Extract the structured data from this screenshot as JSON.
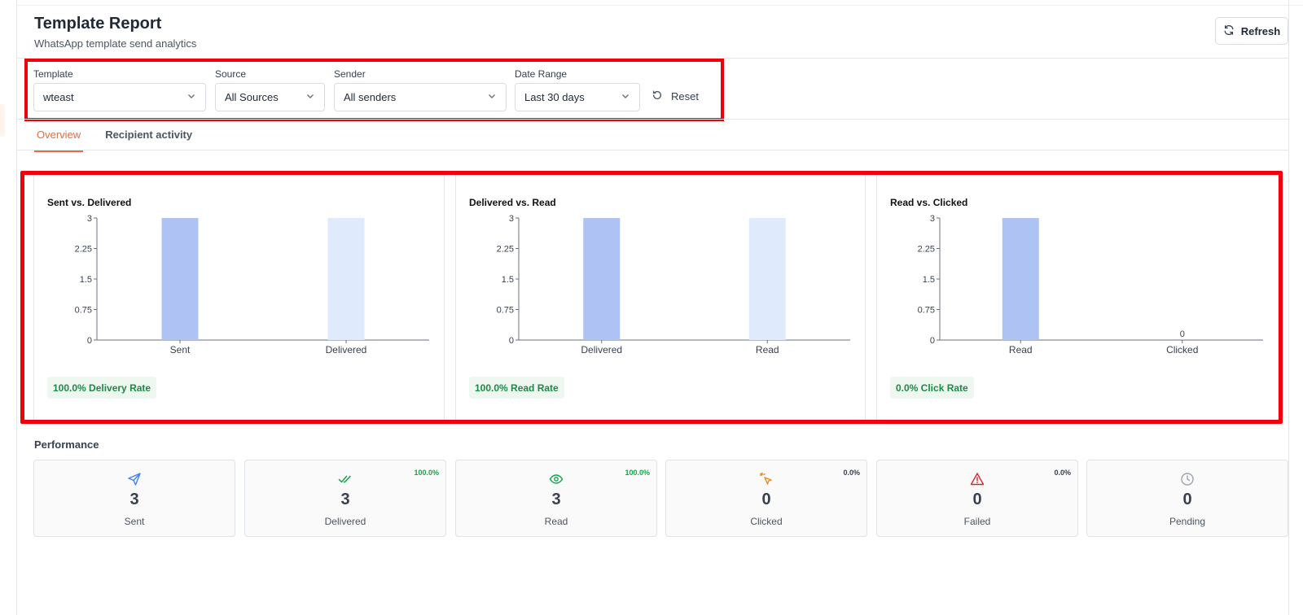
{
  "header": {
    "title": "Template Report",
    "subtitle": "WhatsApp template send analytics"
  },
  "toolbar": {
    "refresh_label": "Refresh",
    "reset_label": "Reset"
  },
  "filters": {
    "template": {
      "label": "Template",
      "value": "wteast"
    },
    "source": {
      "label": "Source",
      "value": "All Sources"
    },
    "sender": {
      "label": "Sender",
      "value": "All senders"
    },
    "date_range": {
      "label": "Date Range",
      "value": "Last 30 days"
    }
  },
  "tabs": [
    {
      "label": "Overview",
      "active": true
    },
    {
      "label": "Recipient activity",
      "active": false
    }
  ],
  "chart_data": [
    {
      "type": "bar",
      "title": "Sent vs. Delivered",
      "categories": [
        "Sent",
        "Delivered"
      ],
      "values": [
        3,
        3
      ],
      "ylim": [
        0,
        3
      ],
      "yticks": [
        "0",
        "0.75",
        "1.5",
        "2.25",
        "3"
      ],
      "colors": [
        "#aec3f4",
        "#dfeafc"
      ],
      "rate": "100.0% Delivery Rate"
    },
    {
      "type": "bar",
      "title": "Delivered vs. Read",
      "categories": [
        "Delivered",
        "Read"
      ],
      "values": [
        3,
        3
      ],
      "ylim": [
        0,
        3
      ],
      "yticks": [
        "0",
        "0.75",
        "1.5",
        "2.25",
        "3"
      ],
      "colors": [
        "#aec3f4",
        "#dfeafc"
      ],
      "rate": "100.0% Read Rate"
    },
    {
      "type": "bar",
      "title": "Read vs. Clicked",
      "categories": [
        "Read",
        "Clicked"
      ],
      "values": [
        3,
        0
      ],
      "ylim": [
        0,
        3
      ],
      "yticks": [
        "0",
        "0.75",
        "1.5",
        "2.25",
        "3"
      ],
      "colors": [
        "#aec3f4",
        "#dfeafc"
      ],
      "data_labels": [
        "",
        "0"
      ],
      "rate": "0.0% Click Rate"
    }
  ],
  "performance": {
    "title": "Performance",
    "stats": [
      {
        "label": "Sent",
        "value": "3",
        "pct": "",
        "icon": "send-icon",
        "color": "#3b82f6"
      },
      {
        "label": "Delivered",
        "value": "3",
        "pct": "100.0%",
        "icon": "double-check-icon",
        "color": "#16a34a"
      },
      {
        "label": "Read",
        "value": "3",
        "pct": "100.0%",
        "icon": "eye-icon",
        "color": "#16a34a"
      },
      {
        "label": "Clicked",
        "value": "0",
        "pct": "0.0%",
        "icon": "cursor-click-icon",
        "color": "#ea8a1c"
      },
      {
        "label": "Failed",
        "value": "0",
        "pct": "0.0%",
        "icon": "warning-icon",
        "color": "#dc2626"
      },
      {
        "label": "Pending",
        "value": "0",
        "pct": "",
        "icon": "clock-icon",
        "color": "#9ca3af"
      }
    ],
    "pct_color_green": "#16a34a",
    "pct_color_gray": "#374151"
  }
}
